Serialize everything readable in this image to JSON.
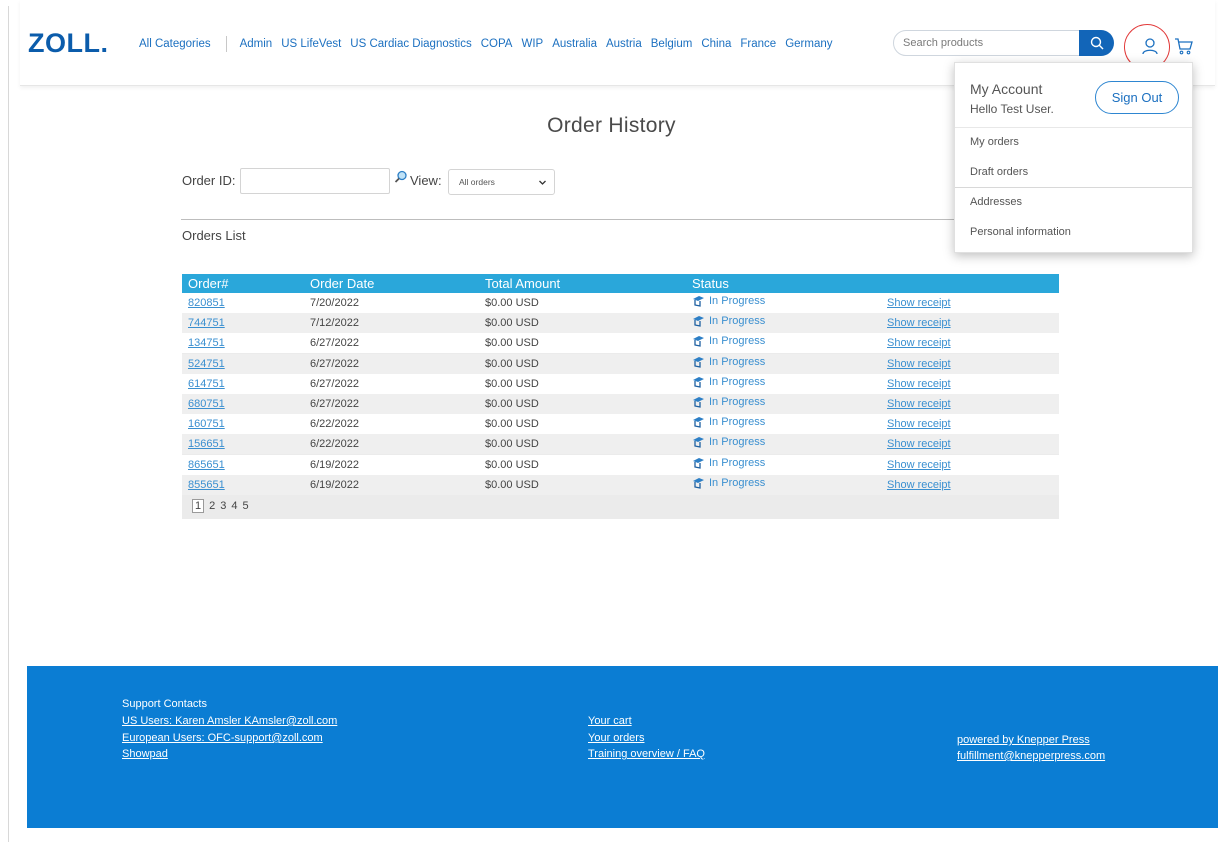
{
  "header": {
    "logo": "ZOLL",
    "logo_dot": ".",
    "nav": [
      "All Categories",
      "Admin",
      "US LifeVest",
      "US Cardiac Diagnostics",
      "COPA",
      "WIP",
      "Australia",
      "Austria",
      "Belgium",
      "China",
      "France",
      "Germany"
    ],
    "search_placeholder": "Search products"
  },
  "account_menu": {
    "title": "My Account",
    "greeting": "Hello Test User.",
    "sign_out": "Sign Out",
    "items": [
      "My orders",
      "Draft orders",
      "Addresses",
      "Personal information"
    ]
  },
  "main": {
    "title": "Order History",
    "order_id_label": "Order ID:",
    "view_label": "View:",
    "view_selected": "All orders",
    "orders_list_label": "Orders List",
    "columns": [
      "Order#",
      "Order Date",
      "Total Amount",
      "Status"
    ],
    "orders": [
      {
        "id": "820851",
        "date": "7/20/2022",
        "amount": "$0.00 USD",
        "status": "In Progress",
        "action": "Show receipt"
      },
      {
        "id": "744751",
        "date": "7/12/2022",
        "amount": "$0.00 USD",
        "status": "In Progress",
        "action": "Show receipt"
      },
      {
        "id": "134751",
        "date": "6/27/2022",
        "amount": "$0.00 USD",
        "status": "In Progress",
        "action": "Show receipt"
      },
      {
        "id": "524751",
        "date": "6/27/2022",
        "amount": "$0.00 USD",
        "status": "In Progress",
        "action": "Show receipt"
      },
      {
        "id": "614751",
        "date": "6/27/2022",
        "amount": "$0.00 USD",
        "status": "In Progress",
        "action": "Show receipt"
      },
      {
        "id": "680751",
        "date": "6/27/2022",
        "amount": "$0.00 USD",
        "status": "In Progress",
        "action": "Show receipt"
      },
      {
        "id": "160751",
        "date": "6/22/2022",
        "amount": "$0.00 USD",
        "status": "In Progress",
        "action": "Show receipt"
      },
      {
        "id": "156651",
        "date": "6/22/2022",
        "amount": "$0.00 USD",
        "status": "In Progress",
        "action": "Show receipt"
      },
      {
        "id": "865651",
        "date": "6/19/2022",
        "amount": "$0.00 USD",
        "status": "In Progress",
        "action": "Show receipt"
      },
      {
        "id": "855651",
        "date": "6/19/2022",
        "amount": "$0.00 USD",
        "status": "In Progress",
        "action": "Show receipt"
      }
    ],
    "pages": [
      "1",
      "2",
      "3",
      "4",
      "5"
    ],
    "current_page": "1"
  },
  "footer": {
    "support_title": "Support Contacts",
    "us_users": "US Users: Karen Amsler KAmsler@zoll.com",
    "eu_users": "European Users: OFC-support@zoll.com",
    "showpad": "Showpad",
    "your_cart": "Your cart",
    "your_orders": "Your orders",
    "training": "Training overview / FAQ",
    "powered_by": "powered by Knepper Press",
    "fulfillment": "fulfillment@knepperpress.com"
  },
  "colors": {
    "brand": "#0b5cab",
    "table_header": "#2aa7da",
    "footer": "#0b7dd3",
    "link": "#3a8fd0"
  },
  "icons": [
    "search-icon",
    "user-icon",
    "cart-icon",
    "magnifier-icon",
    "chevron-down-icon",
    "status-icon"
  ]
}
